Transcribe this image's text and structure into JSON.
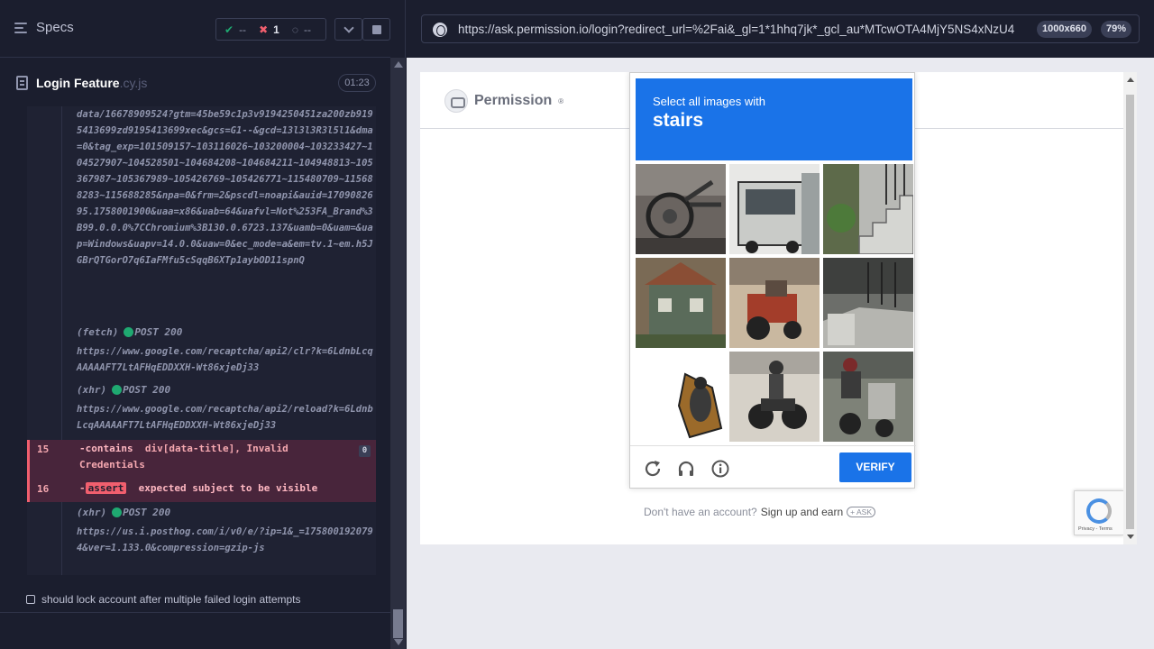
{
  "reporter": {
    "specs_label": "Specs",
    "stats": {
      "passed": "--",
      "failed": "1",
      "pending": "--"
    },
    "spec_name": "Login Feature",
    "spec_ext": ".cy.js",
    "duration": "01:23",
    "log": {
      "url_block": "data/16678909524?gtm=45be59c1p3v9194250451za200zb9195413699zd9195413699xec&gcs=G1--&gcd=13l3l3R3l5l1&dma=0&tag_exp=101509157~103116026~103200004~103233427~104527907~104528501~104684208~104684211~104948813~105367987~105367989~105426769~105426771~115480709~115688283~115688285&npa=0&frm=2&pscdl=noapi&auid=1709082695.1758001900&uaa=x86&uab=64&uafvl=Not%253FA_Brand%3B99.0.0.0%7CChromium%3B130.0.6723.137&uamb=0&uam=&uap=Windows&uapv=14.0.0&uaw=0&ec_mode=a&em=tv.1~em.h5JGBrQTGorO7q6IaFMfu5cSqqB6XTp1aybOD11spnQ",
      "req1_type": "(fetch)",
      "req1_status": "POST 200",
      "req1_url": "https://www.google.com/recaptcha/api2/clr?k=6LdnbLcqAAAAAFT7LtAFHqEDDXXH-Wt86xjeDj33",
      "req2_type": "(xhr)",
      "req2_status": "POST 200",
      "req2_url": "https://www.google.com/recaptcha/api2/reload?k=6LdnbLcqAAAAAFT7LtAFHqEDDXXH-Wt86xjeDj33",
      "fail15_num": "15",
      "fail15_cmd": "-contains",
      "fail15_arg": "div[data-title], Invalid Credentials",
      "fail15_badge": "0",
      "fail16_num": "16",
      "fail16_dash": "-",
      "fail16_cmd": "assert",
      "fail16_text": "expected subject to be visible",
      "req3_type": "(xhr)",
      "req3_status": "POST 200",
      "req3_url": "https://us.i.posthog.com/i/v0/e/?ip=1&_=1758001920794&ver=1.133.0&compression=gzip-js"
    },
    "next_test": "should lock account after multiple failed login attempts"
  },
  "preview": {
    "url": "https://ask.permission.io/login?redirect_url=%2Fai&_gl=1*1hhq7jk*_gcl_au*MTcwOTA4MjY5NS4xNzU4",
    "viewport": "1000x660",
    "zoom": "79%"
  },
  "app": {
    "brand": "Permission",
    "brand_mark": "®",
    "signup_prefix": "Don't have an account?",
    "signup_link": "Sign up and earn",
    "signup_pill": "+ ASK",
    "recaptcha_text": "Privacy - Terms"
  },
  "captcha": {
    "instruction": "Select all images with",
    "object": "stairs",
    "verify_label": "VERIFY",
    "icons": [
      "reload-icon",
      "audio-icon",
      "info-icon"
    ]
  },
  "colors": {
    "accent_blue": "#1a73e8",
    "pass_green": "#1fa971",
    "fail_red": "#f15f6e"
  }
}
